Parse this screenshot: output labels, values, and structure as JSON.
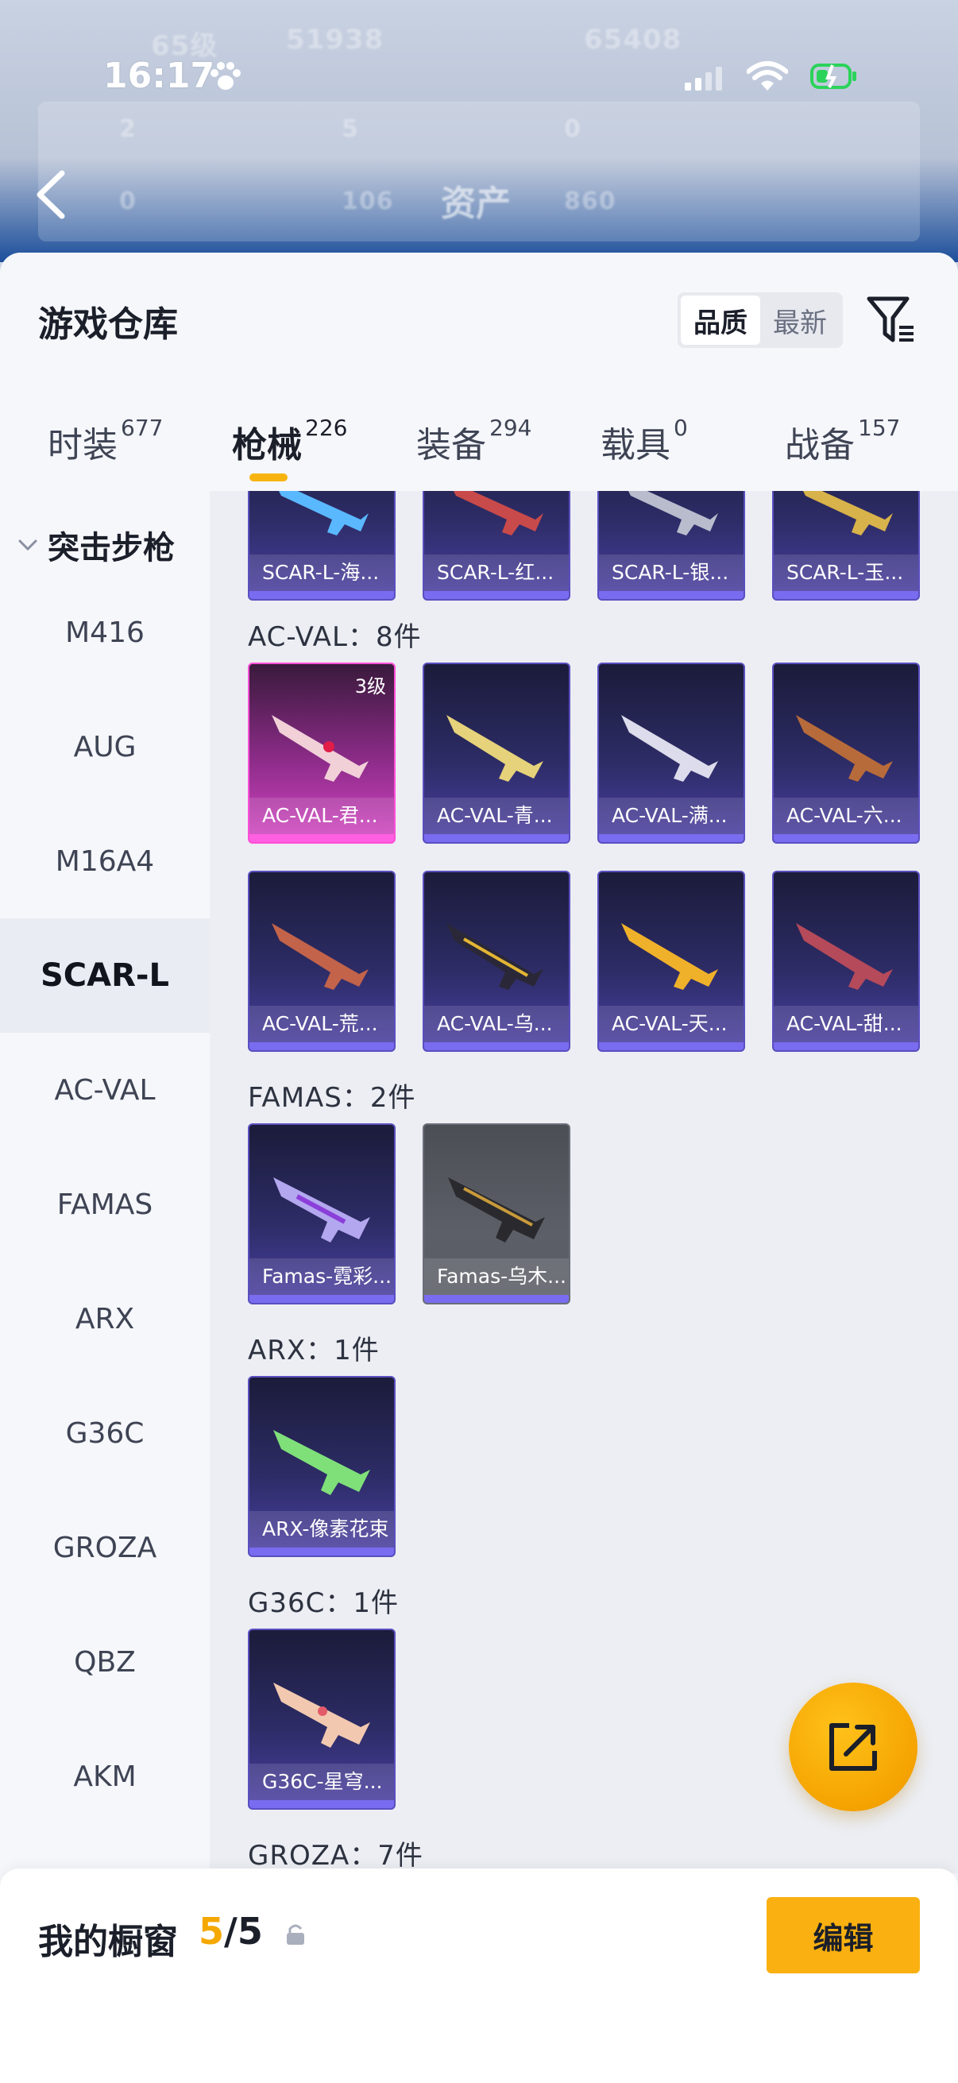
{
  "status_bar": {
    "time": "16:17"
  },
  "background": {
    "ghost_level": "65级",
    "ghost_count_1": "51938",
    "ghost_count_2": "65408",
    "ghost_stats": [
      "2",
      "5",
      "0",
      "0",
      "106",
      "860"
    ],
    "title": "资产"
  },
  "sheet": {
    "title": "游戏仓库",
    "sort_options": [
      {
        "label": "品质",
        "active": true
      },
      {
        "label": "最新",
        "active": false
      }
    ]
  },
  "tabs": [
    {
      "label": "时装",
      "count": "677"
    },
    {
      "label": "枪械",
      "count": "226",
      "active": true
    },
    {
      "label": "装备",
      "count": "294"
    },
    {
      "label": "载具",
      "count": "0"
    },
    {
      "label": "战备",
      "count": "157"
    }
  ],
  "sidebar": {
    "group": "突击步枪",
    "items": [
      "M416",
      "AUG",
      "M16A4",
      "SCAR-L",
      "AC-VAL",
      "FAMAS",
      "ARX",
      "G36C",
      "GROZA",
      "QBZ",
      "AKM"
    ],
    "active": "SCAR-L"
  },
  "sections": {
    "scar_cards": [
      "SCAR-L-海...",
      "SCAR-L-红...",
      "SCAR-L-银...",
      "SCAR-L-玉..."
    ],
    "acval": {
      "title": "AC-VAL：8件",
      "cards": [
        "AC-VAL-君...",
        "AC-VAL-青...",
        "AC-VAL-满...",
        "AC-VAL-六...",
        "AC-VAL-荒...",
        "AC-VAL-乌...",
        "AC-VAL-天...",
        "AC-VAL-甜..."
      ],
      "first_card_level": "3级"
    },
    "famas": {
      "title": "FAMAS：2件",
      "cards": [
        "Famas-霓彩...",
        "Famas-乌木..."
      ]
    },
    "arx": {
      "title": "ARX：1件",
      "cards": [
        "ARX-像素花束"
      ]
    },
    "g36c": {
      "title": "G36C：1件",
      "cards": [
        "G36C-星穹..."
      ]
    },
    "groza": {
      "title": "GROZA：7件"
    }
  },
  "showcase": {
    "label": "我的橱窗",
    "current": "5",
    "separator": "/",
    "total": "5",
    "edit_label": "编辑"
  },
  "colors": {
    "accent": "#f9b010",
    "card_purple": "#2d2c66",
    "card_pink": "#d447c3",
    "card_grey": "#5c5f67"
  },
  "icons": [
    "paw-icon",
    "signal-icon",
    "wifi-icon",
    "battery-icon",
    "back-icon",
    "filter-icon",
    "chevron-down-icon",
    "share-icon",
    "lock-icon"
  ]
}
